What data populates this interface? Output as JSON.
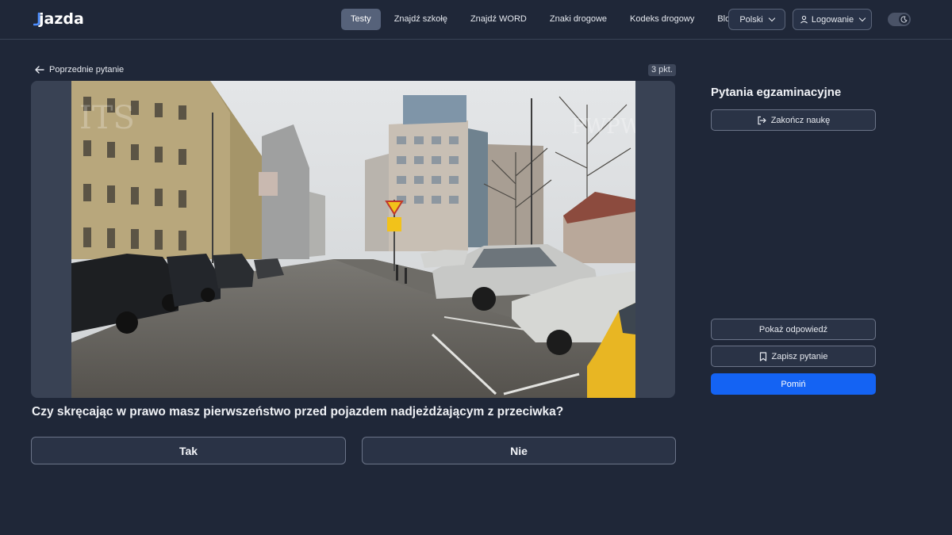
{
  "brand": {
    "name": "jazda"
  },
  "nav": {
    "items": [
      {
        "label": "Testy",
        "active": true
      },
      {
        "label": "Znajdź szkołę",
        "active": false
      },
      {
        "label": "Znajdź WORD",
        "active": false
      },
      {
        "label": "Znaki drogowe",
        "active": false
      },
      {
        "label": "Kodeks drogowy",
        "active": false
      },
      {
        "label": "Blog",
        "active": false
      }
    ],
    "language": "Polski",
    "login": "Logowanie"
  },
  "question_nav": {
    "prev_label": "Poprzednie pytanie",
    "points": "3 pkt."
  },
  "question": {
    "text": "Czy skręcając w prawo masz pierwszeństwo przed pojazdem nadjeżdżającym z przeciwka?"
  },
  "answers": {
    "yes": "Tak",
    "no": "Nie"
  },
  "sidebar": {
    "title": "Pytania egzaminacyjne",
    "end_label": "Zakończ naukę",
    "show_answer_label": "Pokaż odpowiedź",
    "save_label": "Zapisz pytanie",
    "skip_label": "Pomiń"
  },
  "colors": {
    "background": "#1f2738",
    "accent": "#1463f3",
    "active_nav": "#56627a"
  },
  "icons": [
    "arrow-left-icon",
    "chevron-down-icon",
    "user-icon",
    "moon-icon",
    "logout-icon",
    "bookmark-icon"
  ]
}
